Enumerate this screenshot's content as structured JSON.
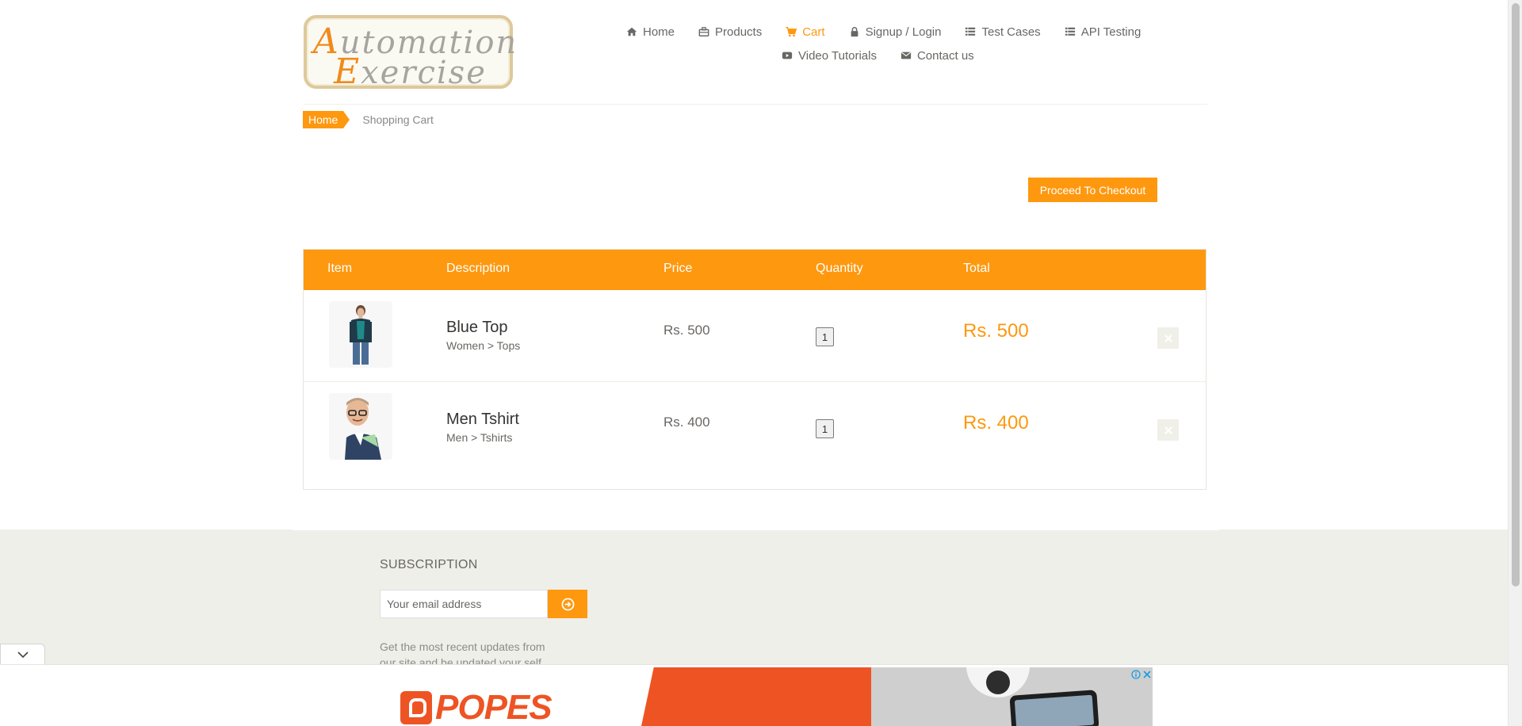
{
  "site": {
    "logo_line1_cap": "A",
    "logo_line1_rest": "utomation",
    "logo_line2_cap": "E",
    "logo_line2_rest": "xercise"
  },
  "nav": {
    "items": [
      {
        "label": "Home",
        "icon": "home-icon"
      },
      {
        "label": "Products",
        "icon": "products-icon"
      },
      {
        "label": "Cart",
        "icon": "cart-icon",
        "active": true
      },
      {
        "label": "Signup / Login",
        "icon": "lock-icon"
      },
      {
        "label": "Test Cases",
        "icon": "list-icon"
      },
      {
        "label": "API Testing",
        "icon": "list-icon"
      },
      {
        "label": "Video Tutorials",
        "icon": "youtube-icon"
      },
      {
        "label": "Contact us",
        "icon": "envelope-icon"
      }
    ]
  },
  "breadcrumb": {
    "home": "Home",
    "current": "Shopping Cart"
  },
  "checkout": {
    "label": "Proceed To Checkout"
  },
  "cart": {
    "headers": [
      "Item",
      "Description",
      "Price",
      "Quantity",
      "Total"
    ],
    "rows": [
      {
        "name": "Blue Top",
        "category": "Women > Tops",
        "price": "Rs. 500",
        "quantity": "1",
        "total": "Rs. 500"
      },
      {
        "name": "Men Tshirt",
        "category": "Men > Tshirts",
        "price": "Rs. 400",
        "quantity": "1",
        "total": "Rs. 400"
      }
    ]
  },
  "footer": {
    "subscription_title": "SUBSCRIPTION",
    "email_placeholder": "Your email address",
    "description": "Get the most recent updates from our site and be updated your self..."
  },
  "ad": {
    "brand": "POPES"
  },
  "colors": {
    "accent": "#fe980f",
    "text": "#696763",
    "footer_bg": "#efefe9",
    "ad_brand": "#ee5423"
  }
}
